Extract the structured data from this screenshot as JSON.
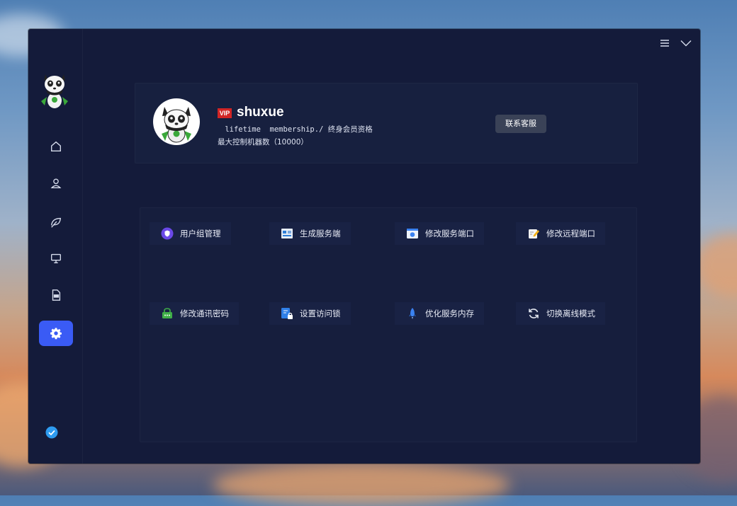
{
  "window_controls": {
    "menu_icon": "hamburger-menu-icon",
    "collapse_icon": "chevron-down-icon"
  },
  "sidebar": {
    "logo": "panda-mascot-logo",
    "items": [
      {
        "icon": "home-icon",
        "active": false
      },
      {
        "icon": "user-icon",
        "active": false
      },
      {
        "icon": "leaf-icon",
        "active": false
      },
      {
        "icon": "monitor-icon",
        "active": false
      },
      {
        "icon": "log-file-icon",
        "active": false
      },
      {
        "icon": "gear-icon",
        "active": true
      }
    ],
    "status_icon": "check-circle-icon"
  },
  "profile": {
    "vip_label": "VIP",
    "username": "shuxue",
    "membership": " lifetime  membership./ 终身会员资格",
    "max_machines": "最大控制机器数（10000）",
    "contact_button": "联系客服"
  },
  "settings": [
    {
      "label": "用户组管理",
      "icon": "shield-icon"
    },
    {
      "label": "生成服务端",
      "icon": "server-build-icon"
    },
    {
      "label": "修改服务端口",
      "icon": "window-port-icon"
    },
    {
      "label": "修改远程端口",
      "icon": "edit-note-icon"
    },
    {
      "label": "修改通讯密码",
      "icon": "chat-password-icon"
    },
    {
      "label": "设置访问锁",
      "icon": "lock-icon"
    },
    {
      "label": "优化服务内存",
      "icon": "rocket-icon"
    },
    {
      "label": "切换离线模式",
      "icon": "refresh-icon"
    }
  ],
  "colors": {
    "window_bg": "#141b3a",
    "accent": "#3a5bf5",
    "vip_red": "#d22525"
  }
}
